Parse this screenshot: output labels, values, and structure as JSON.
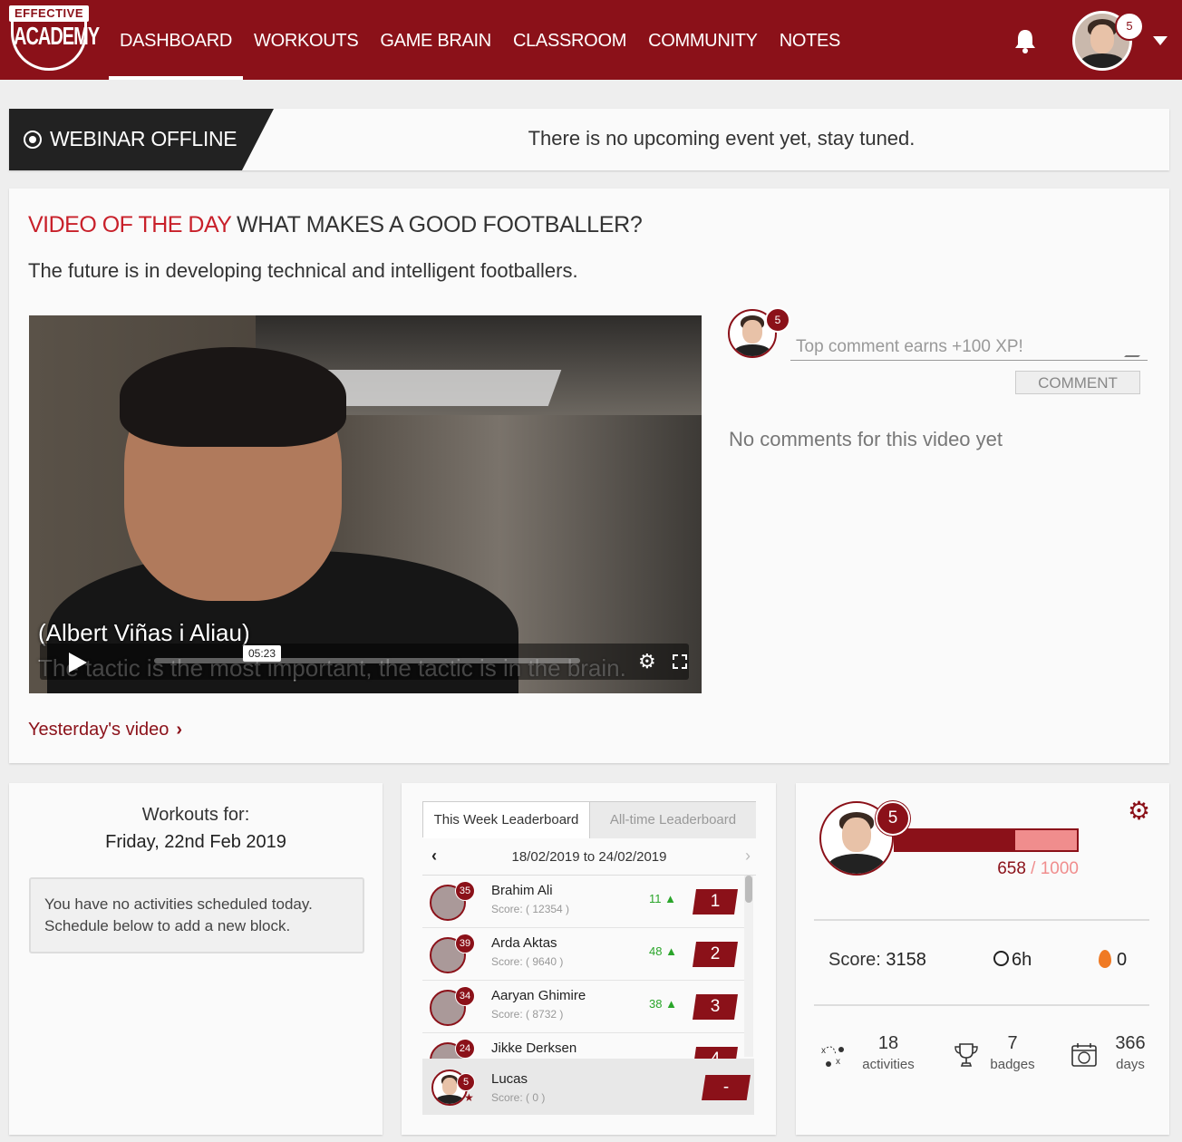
{
  "nav": {
    "logo_top": "EFFECTIVE",
    "logo_main": "ACADEMY",
    "items": [
      {
        "label": "DASHBOARD",
        "active": true
      },
      {
        "label": "WORKOUTS"
      },
      {
        "label": "GAME BRAIN"
      },
      {
        "label": "CLASSROOM"
      },
      {
        "label": "COMMUNITY"
      },
      {
        "label": "NOTES"
      }
    ],
    "user_level": "5"
  },
  "webinar": {
    "status": "WEBINAR OFFLINE",
    "message": "There is no upcoming event yet, stay tuned."
  },
  "video": {
    "heading": "VIDEO OF THE DAY",
    "title": "WHAT MAKES A GOOD FOOTBALLER?",
    "description": "The future is in developing technical and intelligent footballers.",
    "subtitle_line1": "(Albert Viñas i Aliau)",
    "subtitle_line2": "The tactic is the most important, the tactic is in the brain.",
    "hover_time": "05:23",
    "yesterday_link": "Yesterday's video",
    "comment_level": "5",
    "comment_placeholder": "Top comment earns +100 XP!",
    "comment_button": "COMMENT",
    "no_comments": "No comments for this video yet"
  },
  "workouts": {
    "label": "Workouts for:",
    "date": "Friday, 22nd Feb 2019",
    "empty_note": "You have no activities scheduled today. Schedule below to add a new block."
  },
  "leaderboard": {
    "tab_week": "This Week Leaderboard",
    "tab_all": "All-time Leaderboard",
    "range": "18/02/2019 to 24/02/2019",
    "rows": [
      {
        "level": "35",
        "name": "Brahim Ali",
        "score": "Score: ( 12354 )",
        "change": "11 ▲",
        "rank": "1"
      },
      {
        "level": "39",
        "name": "Arda Aktas",
        "score": "Score: ( 9640 )",
        "change": "48 ▲",
        "rank": "2"
      },
      {
        "level": "34",
        "name": "Aaryan Ghimire",
        "score": "Score: ( 8732 )",
        "change": "38 ▲",
        "rank": "3"
      },
      {
        "level": "24",
        "name": "Jikke Derksen",
        "score": "",
        "change": "",
        "rank": "4"
      }
    ],
    "me": {
      "level": "5",
      "name": "Lucas",
      "score": "Score: ( 0 )",
      "rank": "-"
    }
  },
  "profile": {
    "level": "5",
    "xp": "658",
    "xp_max": "/ 1000",
    "xp_progress": 0.658,
    "score_label": "Score:",
    "score": "3158",
    "time": "6h",
    "streak": "0",
    "stats": [
      {
        "icon": "tactics-icon",
        "value": "18",
        "label": "activities"
      },
      {
        "icon": "trophy-icon",
        "value": "7",
        "label": "badges"
      },
      {
        "icon": "calendar-ball-icon",
        "value": "366",
        "label": "days"
      }
    ]
  },
  "colors": {
    "brand": "#8b1119",
    "accent_red": "#c8202a",
    "xp_remaining": "#f08d8d",
    "positive": "#2aa52a"
  }
}
